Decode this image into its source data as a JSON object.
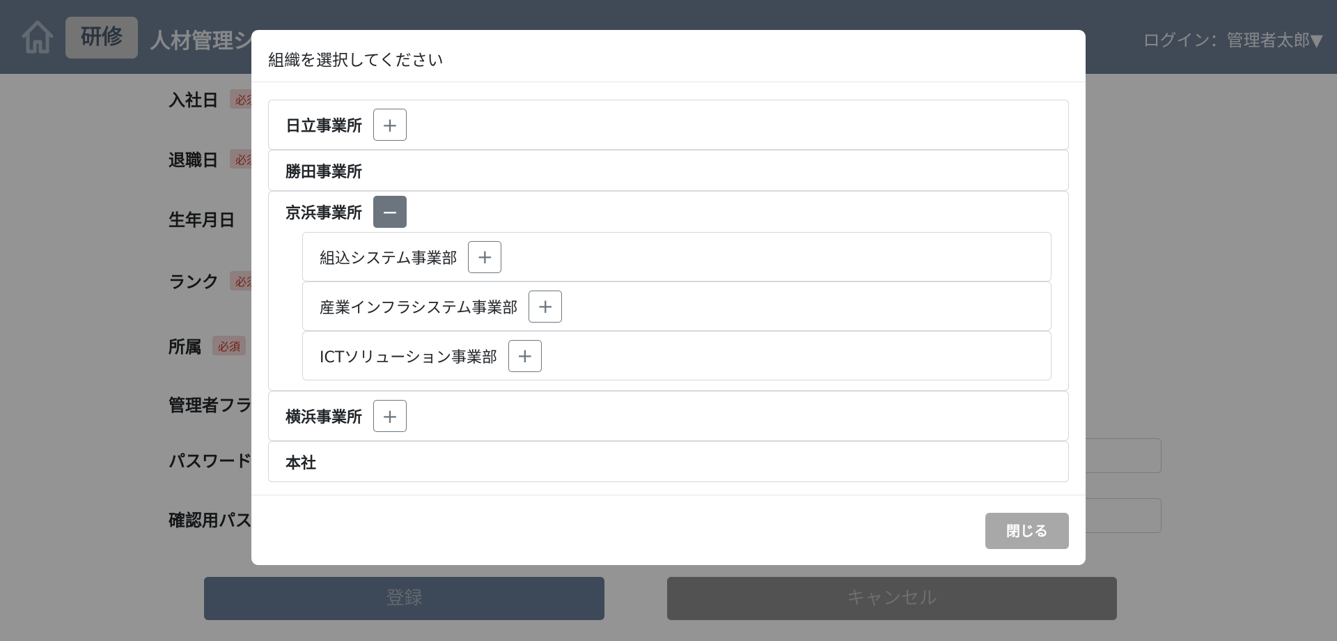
{
  "header": {
    "badge": "研修",
    "title": "人材管理システム",
    "login": "ログイン：管理者太郎▼"
  },
  "form": {
    "required_badge": "必須",
    "labels": {
      "hire_date": "入社日",
      "retire_date": "退職日",
      "birth_date": "生年月日",
      "rank": "ランク",
      "affiliation": "所属",
      "admin_flag": "管理者フラグ",
      "password": "パスワード",
      "confirm_password": "確認用パスワード"
    },
    "register_button": "登録",
    "cancel_button": "キャンセル"
  },
  "modal": {
    "title": "組織を選択してください",
    "close_button": "閉じる",
    "organizations": [
      {
        "label": "日立事業所",
        "toggle": "+"
      },
      {
        "label": "勝田事業所"
      },
      {
        "label": "京浜事業所",
        "toggle": "−",
        "children": [
          {
            "label": "組込システム事業部",
            "toggle": "+"
          },
          {
            "label": "産業インフラシステム事業部",
            "toggle": "+"
          },
          {
            "label": "ICTソリューション事業部",
            "toggle": "+"
          }
        ]
      },
      {
        "label": "横浜事業所",
        "toggle": "+"
      },
      {
        "label": "本社"
      }
    ]
  }
}
